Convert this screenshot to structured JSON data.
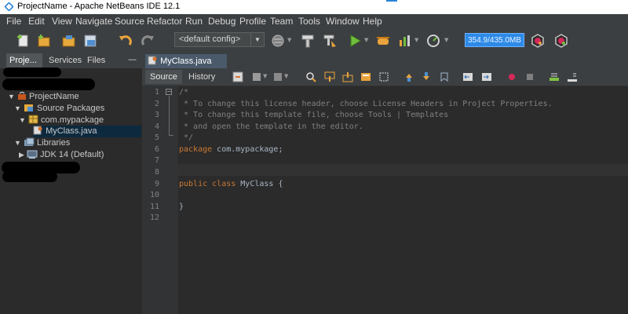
{
  "window": {
    "title": "ProjectName - Apache NetBeans IDE 12.1"
  },
  "menu": [
    "File",
    "Edit",
    "View",
    "Navigate",
    "Source",
    "Refactor",
    "Run",
    "Debug",
    "Profile",
    "Team",
    "Tools",
    "Window",
    "Help"
  ],
  "toolbar": {
    "config_value": "<default config>",
    "memory_label": "354.9/435.0MB",
    "icons": [
      "new-file-icon",
      "new-project-icon",
      "open-project-icon",
      "close-project-icon",
      "undo-icon",
      "redo-icon",
      "globe-icon",
      "build-icon",
      "clean-build-icon",
      "run-icon",
      "debug-icon",
      "profile-icon",
      "gauge-icon",
      "gc-icon",
      "gc-heap-icon"
    ]
  },
  "left_panel": {
    "tabs": [
      "Proje...",
      "Services",
      "Files"
    ],
    "tree": [
      {
        "label": "ProjectName"
      },
      {
        "label": "Source Packages"
      },
      {
        "label": "com.mypackage"
      },
      {
        "label": "MyClass.java"
      },
      {
        "label": "Libraries"
      },
      {
        "label": "JDK 14 (Default)"
      }
    ]
  },
  "editor": {
    "tab_label": "MyClass.java",
    "view_source": "Source",
    "view_history": "History",
    "line_numbers": [
      "1",
      "2",
      "3",
      "4",
      "5",
      "6",
      "7",
      "8",
      "9",
      "10",
      "11",
      "12"
    ],
    "code": {
      "l1": "/*",
      "l2": " * To change this license header, choose License Headers in Project Properties.",
      "l3": " * To change this template file, choose Tools | Templates",
      "l4": " * and open the template in the editor.",
      "l5": " */",
      "l6_kw": "package",
      "l6_rest": " com.mypackage;",
      "l9_kw1": "public",
      "l9_kw2": "class",
      "l9_rest": " MyClass {",
      "l11": "}"
    }
  },
  "colors": {
    "accent_blue": "#2d8ae8",
    "keyword": "#cc7832",
    "comment": "#808080",
    "background": "#2b2b2b",
    "panel": "#3c3f41"
  }
}
